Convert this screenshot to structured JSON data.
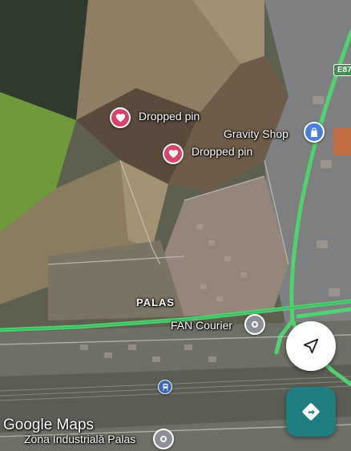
{
  "map": {
    "road_color": "#4fd26f",
    "accent_color": "#1e7e83"
  },
  "pins": [
    {
      "label": "Dropped pin",
      "icon": "heart-icon",
      "color": "#d9436a"
    },
    {
      "label": "Dropped pin",
      "icon": "heart-icon",
      "color": "#d9436a"
    }
  ],
  "places": {
    "gravity_shop": {
      "label": "Gravity Shop",
      "icon": "shopping-bag-icon",
      "color": "#4a7fe0"
    },
    "fan_courier": {
      "label": "FAN Courier",
      "icon": "location-icon",
      "color": "#8a8f98"
    },
    "zona": {
      "label": "Zona Industrială Palas",
      "icon": "location-icon",
      "color": "#8a8f98"
    },
    "palas": {
      "label": "PALAS"
    },
    "station": {
      "icon": "train-icon"
    }
  },
  "road_shield": "E87",
  "controls": {
    "recenter_icon": "navigation-arrow-icon",
    "directions_icon": "directions-icon"
  },
  "watermark": "Google Maps"
}
